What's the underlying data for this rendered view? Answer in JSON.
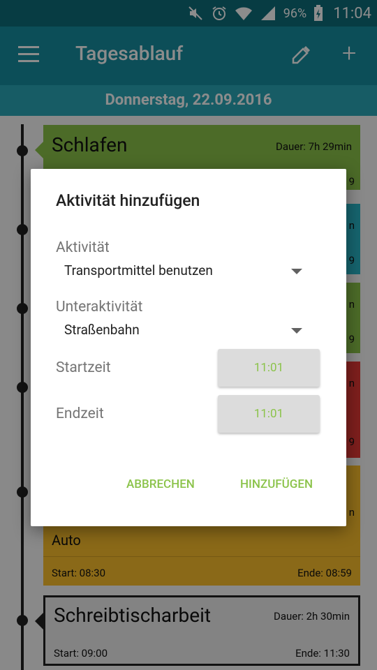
{
  "status_bar": {
    "battery_percent": "96%",
    "time": "11:04",
    "icons": [
      "mute-icon",
      "alarm-icon",
      "wifi-icon",
      "signal-icon",
      "battery-charging-icon"
    ]
  },
  "toolbar": {
    "title": "Tagesablauf",
    "icons": [
      "menu-icon",
      "color-picker-icon",
      "add-icon"
    ]
  },
  "date": "Donnerstag, 22.09.2016",
  "timeline": [
    {
      "name": "Schlafen",
      "duration": "Dauer: 7h 29min",
      "edge_bottom": "9",
      "color": "#8bc34a"
    },
    {
      "edge_top": "n",
      "edge_bottom": "9",
      "color": "#29b6c8"
    },
    {
      "edge_top": "n",
      "edge_bottom": "9",
      "color": "#8bc34a"
    },
    {
      "edge_top": "n",
      "edge_bottom": "9",
      "color": "#e53935"
    },
    {
      "subactivity": "Auto",
      "start": "Start: 08:30",
      "end": "Ende: 08:59",
      "edge_top": "n",
      "color": "#fbc02d"
    },
    {
      "name": "Schreibtischarbeit",
      "duration": "Dauer: 2h 30min",
      "start": "Start: 09:00",
      "end": "Ende: 11:30",
      "color": "#eeeeee"
    }
  ],
  "dialog": {
    "title": "Aktivität hinzufügen",
    "activity_label": "Aktivität",
    "activity_value": "Transportmittel benutzen",
    "subactivity_label": "Unteraktivität",
    "subactivity_value": "Straßenbahn",
    "start_label": "Startzeit",
    "start_value": "11:01",
    "end_label": "Endzeit",
    "end_value": "11:01",
    "cancel_label": "ABBRECHEN",
    "add_label": "HINZUFÜGEN",
    "accent_color": "#8bc34a"
  }
}
